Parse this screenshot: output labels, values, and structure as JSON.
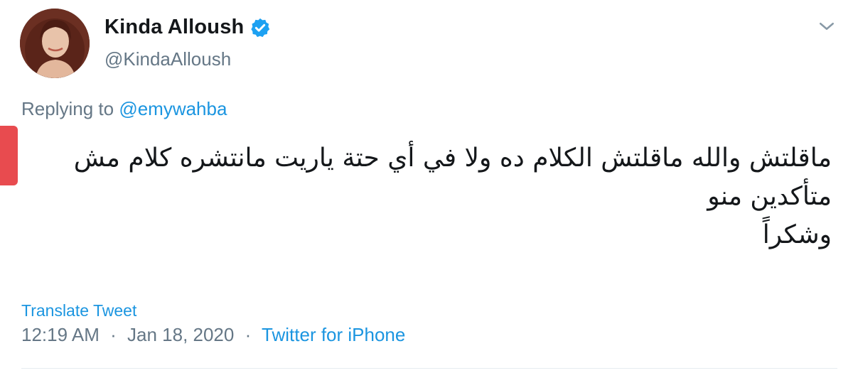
{
  "user": {
    "display_name": "Kinda Alloush",
    "handle": "@KindaAlloush",
    "verified": true
  },
  "reply": {
    "prefix": "Replying to",
    "mention": "@emywahba"
  },
  "tweet": {
    "lines": [
      "ماقلتش والله ماقلتش الكلام ده ولا في أي حتة ياريت مانتشره كلام مش",
      "متأكدين منو",
      "وشكراً"
    ]
  },
  "translate_label": "Translate Tweet",
  "meta": {
    "time": "12:19 AM",
    "separator": "·",
    "date": "Jan 18, 2020",
    "source": "Twitter for iPhone"
  },
  "icons": {
    "verified": "verified-badge-icon",
    "menu": "chevron-down-icon"
  },
  "colors": {
    "link": "#1b95e0",
    "muted": "#657786",
    "text": "#14171a",
    "verified": "#1da1f2",
    "marker": "#e84b4f"
  }
}
